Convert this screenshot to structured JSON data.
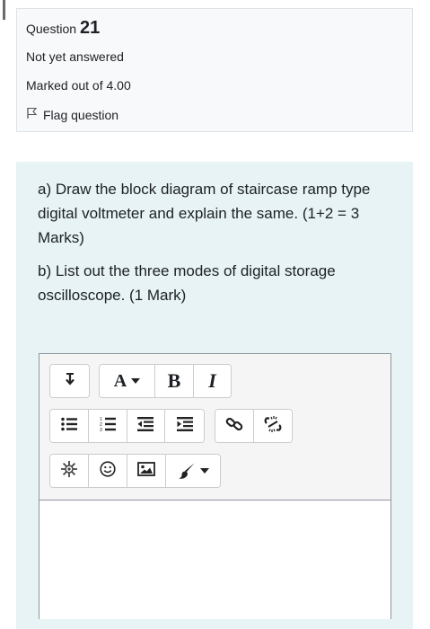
{
  "question": {
    "label": "Question",
    "number": "21",
    "state": "Not yet answered",
    "grade": "Marked out of 4.00",
    "flag_label": "Flag question"
  },
  "question_text": {
    "part_a": "a) Draw the block diagram of staircase ramp type digital voltmeter  and explain  the same. (1+2 = 3 Marks)",
    "part_b": "b) List out the three modes of digital storage oscilloscope. (1 Mark)"
  },
  "editor": {
    "toolbar": {
      "font_label": "A",
      "bold_label": "B",
      "italic_label": "I"
    },
    "icons": [
      "collapse-icon",
      "font-color-icon",
      "bold-icon",
      "italic-icon",
      "unordered-list-icon",
      "ordered-list-icon",
      "outdent-icon",
      "indent-icon",
      "link-icon",
      "unlink-icon",
      "special-character-icon",
      "emoticon-icon",
      "image-icon",
      "paintbrush-icon"
    ],
    "text_value": ""
  },
  "colors": {
    "info_background": "#f8f9fa",
    "content_background": "#e7f3f5",
    "text": "#1d2125",
    "border": "#dee2e6"
  }
}
